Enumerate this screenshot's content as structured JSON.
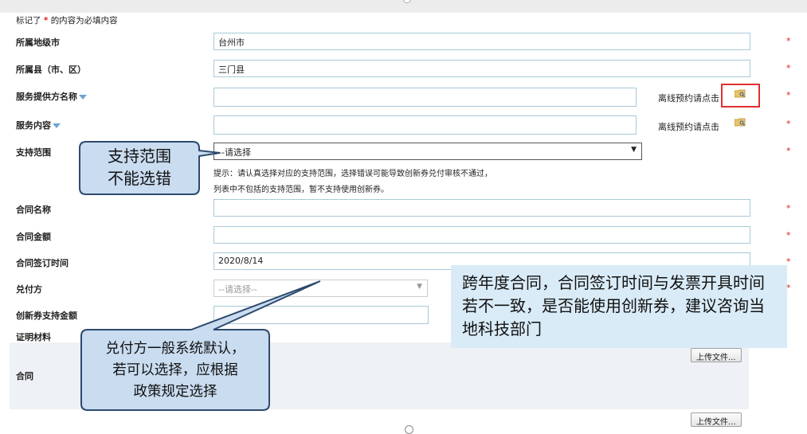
{
  "note": {
    "prefix": "标记了",
    "star": "*",
    "suffix": "的内容为必填内容"
  },
  "required_mark": "*",
  "fields": {
    "city": {
      "label": "所属地级市",
      "value": "台州市"
    },
    "county": {
      "label": "所属县（市、区）",
      "value": "三门县"
    },
    "provider": {
      "label": "服务提供方名称",
      "value": "",
      "offline": "离线预约请点击"
    },
    "service": {
      "label": "服务内容",
      "value": "",
      "offline": "离线预约请点击"
    },
    "scope": {
      "label": "支持范围",
      "selected": "--请选择",
      "hint_line1": "提示：请认真选择对应的支持范围，选择错误可能导致创新券兑付审核不通过，",
      "hint_line2": "列表中不包括的支持范围，暂不支持使用创新券。"
    },
    "contract_name": {
      "label": "合同名称",
      "value": ""
    },
    "contract_amount": {
      "label": "合同金额",
      "value": ""
    },
    "sign_date": {
      "label": "合同签订时间",
      "value": "2020/8/14"
    },
    "payer": {
      "label": "兑付方",
      "selected": "--请选择--"
    },
    "voucher_amount": {
      "label": "创新券支持金额",
      "value": ""
    },
    "proof": {
      "label": "证明材料"
    },
    "contract_file": {
      "label": "合同"
    }
  },
  "upload_label": "上传文件...",
  "callouts": {
    "scope": {
      "line1": "支持范围",
      "line2": "不能选错"
    },
    "payer": {
      "line1": "兑付方一般系统默认，",
      "line2": "若可以选择，应根据",
      "line3": "政策规定选择"
    },
    "cross_year": "跨年度合同，合同签订时间与发票开具时间若不一致，是否能使用创新券，建议咨询当地科技部门"
  },
  "colors": {
    "required": "#e02020",
    "callout_fill": "#c9dcf0",
    "callout_stroke": "#2c4a6e",
    "note_fill": "#d9ebf7"
  }
}
